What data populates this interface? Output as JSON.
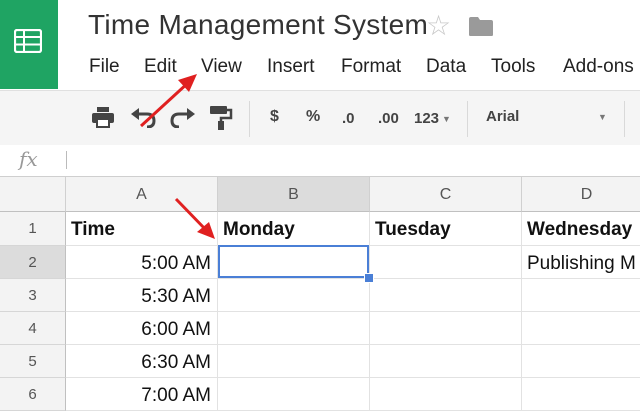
{
  "app": {
    "title": "Time Management System"
  },
  "menu": [
    "File",
    "Edit",
    "View",
    "Insert",
    "Format",
    "Data",
    "Tools",
    "Add-ons"
  ],
  "toolbar": {
    "currency": "$",
    "percent": "%",
    "decimal_decrease": ".0",
    "decimal_increase": ".00",
    "more_formats": "123",
    "font": "Arial"
  },
  "formula_bar": {
    "fx_label": "fx",
    "value": ""
  },
  "grid": {
    "columns": [
      "A",
      "B",
      "C",
      "D"
    ],
    "selected_column": "B",
    "selected_row": "2",
    "rows": [
      {
        "num": "1",
        "cells": [
          "Time",
          "Monday",
          "Tuesday",
          "Wednesday"
        ]
      },
      {
        "num": "2",
        "cells": [
          "5:00 AM",
          "",
          "",
          "Publishing M"
        ]
      },
      {
        "num": "3",
        "cells": [
          "5:30 AM",
          "",
          "",
          ""
        ]
      },
      {
        "num": "4",
        "cells": [
          "6:00 AM",
          "",
          "",
          ""
        ]
      },
      {
        "num": "5",
        "cells": [
          "6:30 AM",
          "",
          "",
          ""
        ]
      },
      {
        "num": "6",
        "cells": [
          "7:00 AM",
          "",
          "",
          ""
        ]
      }
    ]
  },
  "icons": {
    "logo": "sheets-logo-icon",
    "star": "star-icon",
    "folder": "folder-icon",
    "print": "print-icon",
    "undo": "undo-icon",
    "redo": "redo-icon",
    "paint": "paint-format-icon"
  },
  "colors": {
    "brand_green": "#1fa463",
    "selection_blue": "#4a7fd6",
    "arrow_red": "#e02020"
  }
}
